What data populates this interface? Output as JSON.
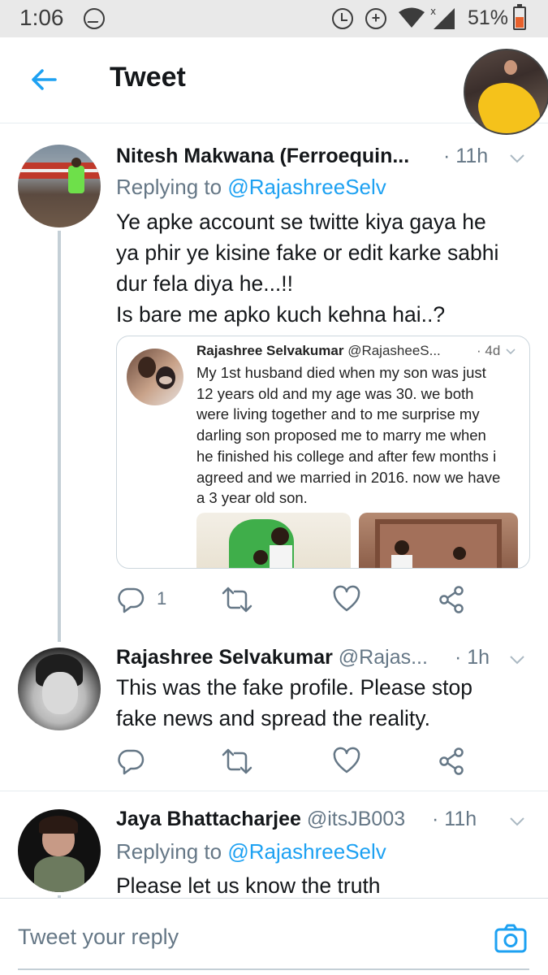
{
  "status_bar": {
    "time": "1:06",
    "battery": "51%",
    "battery_level": 0.51
  },
  "header": {
    "title": "Tweet"
  },
  "tweets": [
    {
      "name": "Nitesh Makwana (Ferroequin...",
      "time": "· 11h",
      "replying_prefix": "Replying to",
      "replying_to": "@RajashreeSelv",
      "text_lines": [
        "Ye apke account se twitte kiya gaya he",
        "ya phir ye kisine fake or edit karke sabhi",
        "dur fela diya he...!!",
        "Is bare me apko kuch kehna hai..?"
      ],
      "reply_count": "1",
      "quote": {
        "name": "Rajashree Selvakumar",
        "handle": "@RajasheeS...",
        "time": "· 4d",
        "text_lines": [
          "My 1st husband died when my son was just",
          "12 years old and my age was 30. we both",
          "were living together and to me surprise my",
          "darling son proposed me to marry me when",
          "he finished his college and after few months i",
          "agreed and we married in 2016. now we have",
          "a 3 year old son."
        ]
      }
    },
    {
      "name": "Rajashree Selvakumar",
      "handle": "@Rajas...",
      "time": "· 1h",
      "text_lines": [
        "This was the fake profile. Please stop",
        "fake news and spread the reality."
      ]
    },
    {
      "name": "Jaya Bhattacharjee",
      "handle": "@itsJB003",
      "time": "· 11h",
      "replying_prefix": "Replying to",
      "replying_to": "@RajashreeSelv",
      "text_lines": [
        "Please let us know the truth"
      ]
    }
  ],
  "compose": {
    "placeholder": "Tweet your reply"
  },
  "icons": [
    "messenger-icon",
    "alarm-icon",
    "data-saver-icon",
    "wifi-icon",
    "signal-icon",
    "battery-icon",
    "back-arrow-icon",
    "chevron-down-icon",
    "reply-icon",
    "retweet-icon",
    "like-icon",
    "share-icon",
    "camera-icon"
  ],
  "colors": {
    "accent": "#1da1f2",
    "secondary_text": "#657786",
    "battery": "#e8612c"
  }
}
